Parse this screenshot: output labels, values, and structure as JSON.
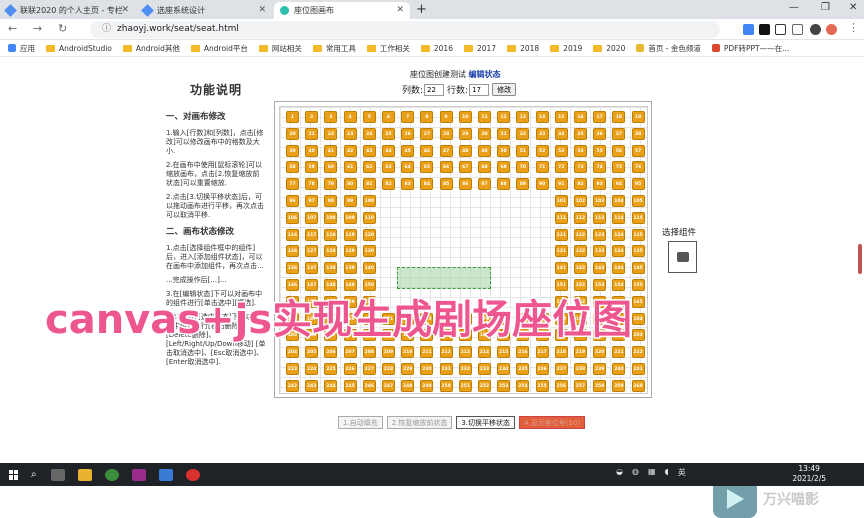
{
  "tabs": [
    {
      "title": "联联2020 的个人主页 - 专栏",
      "active": false,
      "color": "#4f8ef3"
    },
    {
      "title": "选座系统设计",
      "active": false,
      "color": "#4f8ef3"
    },
    {
      "title": "座位图画布",
      "active": true,
      "color": "#2fbfae"
    }
  ],
  "url": "zhaoyj.work/seat/seat.html",
  "bookmarks": [
    "应用",
    "AndroidStudio",
    "Android其他",
    "Android平台",
    "网站相关",
    "常用工具",
    "工作相关",
    "2016",
    "2017",
    "2018",
    "2019",
    "2020",
    "首页 - 金色频道",
    "PDF转PPT——在..."
  ],
  "sidebar": {
    "title": "功能说明",
    "section1": "一、对画布修改",
    "p1": "1.输入[行数]和[列数]，点击[修改]可以修改画布中的格数及大小.",
    "p2": "2.在画布中使用[鼠标滚轮]可以缩放画布，点击[2.恢复缩放前状态]可以重置缩放.",
    "p3": "2.点击[3.切换平移状态]后，可以拖动画布进行平移，再次点击可以取消平移.",
    "section2": "二、画布状态修改",
    "p4": "1.点击[选择组件框中的组件]后，进入[添加组件状态]，可以在画布中添加组件，再次点击...",
    "p5": "...完成操作后[...]...",
    "p6": "3.在[编辑状态]下可以对画布中的组件进行[单击选中][框选].",
    "p7": "3.1在组件[选中状态]下可以对选中组件进行[右击删除]、[Delete删除]、[Left/Right/Up/Down移动] [单击取消选中]、[Esc取消选中]、[Enter取消选中]."
  },
  "header": {
    "prefix": "座位图创建测试",
    "state": "编辑状态"
  },
  "controls": {
    "cols_label": "列数:",
    "cols": "22",
    "rows_label": "行数:",
    "rows": "17",
    "modify": "修改"
  },
  "component_panel": {
    "title": "选择组件"
  },
  "buttons": [
    "1.自动填充",
    "2.恢复缩放前状态",
    "3.切换平移状态",
    "4.显示座位号(10)"
  ],
  "overlay": "canvas+js实现生成剧场座位图",
  "watermark": "万兴喵影",
  "clock": {
    "time": "13:49",
    "date": "2021/2/5"
  }
}
